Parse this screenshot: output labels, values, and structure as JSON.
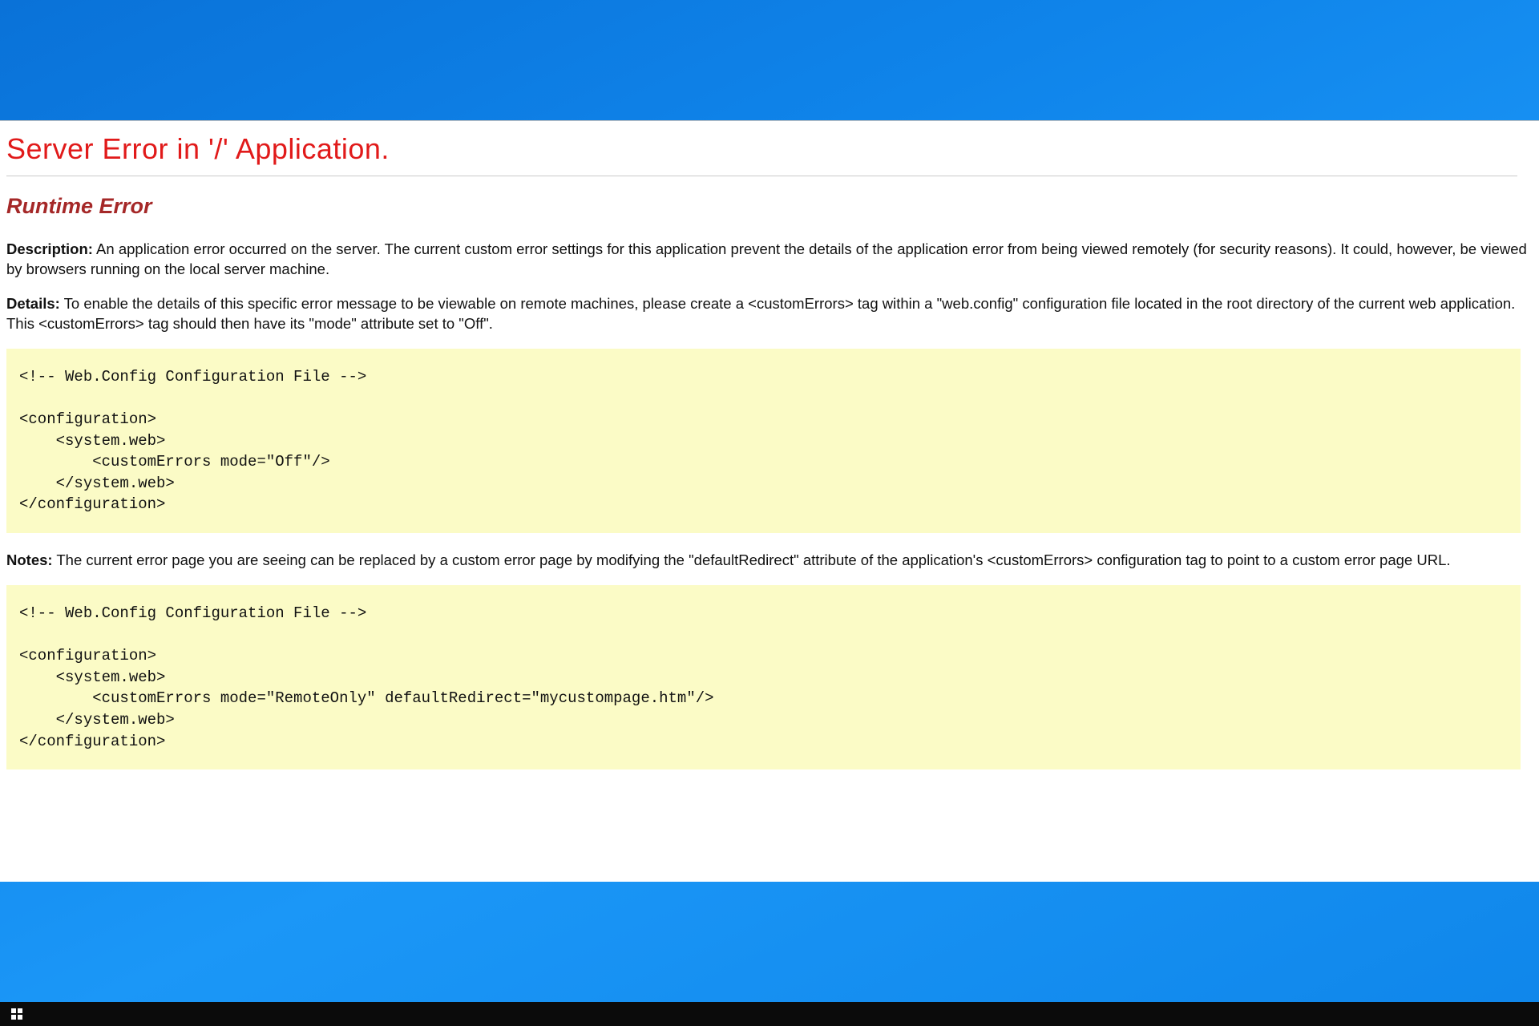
{
  "page": {
    "title": "Server Error in '/' Application.",
    "subtitle": "Runtime Error",
    "description_label": "Description:",
    "description_text": " An application error occurred on the server. The current custom error settings for this application prevent the details of the application error from being viewed remotely (for security reasons). It could, however, be viewed by browsers running on the local server machine.",
    "details_label": "Details:",
    "details_text": " To enable the details of this specific error message to be viewable on remote machines, please create a <customErrors> tag within a \"web.config\" configuration file located in the root directory of the current web application. This <customErrors> tag should then have its \"mode\" attribute set to \"Off\".",
    "codeblock1": "<!-- Web.Config Configuration File -->\n\n<configuration>\n    <system.web>\n        <customErrors mode=\"Off\"/>\n    </system.web>\n</configuration>",
    "notes_label": "Notes:",
    "notes_text": " The current error page you are seeing can be replaced by a custom error page by modifying the \"defaultRedirect\" attribute of the application's <customErrors> configuration tag to point to a custom error page URL.",
    "codeblock2": "<!-- Web.Config Configuration File -->\n\n<configuration>\n    <system.web>\n        <customErrors mode=\"RemoteOnly\" defaultRedirect=\"mycustompage.htm\"/>\n    </system.web>\n</configuration>"
  }
}
